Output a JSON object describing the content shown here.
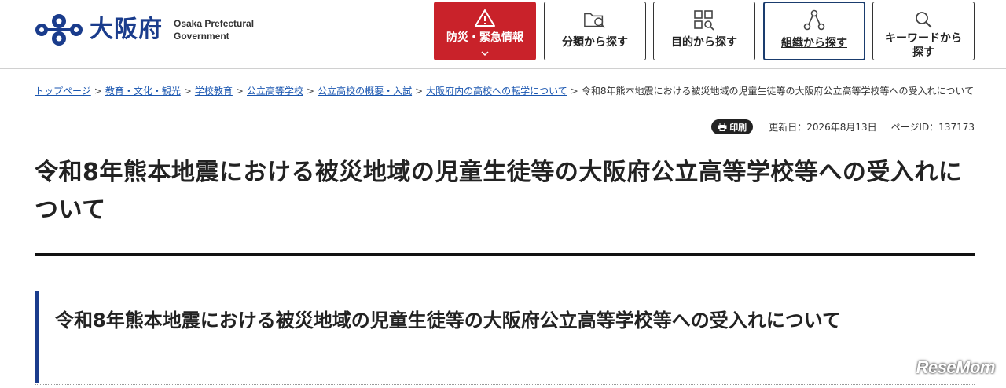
{
  "header": {
    "logo_jp": "大阪府",
    "logo_en_line1": "Osaka Prefectural",
    "logo_en_line2": "Government",
    "nav": [
      {
        "label": "防災・緊急情報",
        "icon": "warning-icon"
      },
      {
        "label": "分類から探す",
        "icon": "folder-search-icon"
      },
      {
        "label": "目的から探す",
        "icon": "grid-search-icon"
      },
      {
        "label": "組織から探す",
        "icon": "org-chart-icon"
      },
      {
        "label_line1": "キーワードから",
        "label_line2": "探す",
        "icon": "search-icon"
      }
    ]
  },
  "breadcrumb": {
    "items": [
      "トップページ",
      "教育・文化・観光",
      "学校教育",
      "公立高等学校",
      "公立高校の概要・入試",
      "大阪府内の高校への転学について"
    ],
    "current": "令和8年熊本地震における被災地域の児童生徒等の大阪府公立高等学校等への受入れについて",
    "separator": ">"
  },
  "meta": {
    "print_label": "印刷",
    "updated": "更新日：2026年8月13日",
    "page_id": "ページID：137173"
  },
  "page_title": "令和8年熊本地震における被災地域の児童生徒等の大阪府公立高等学校等への受入れについて",
  "section_heading": "令和8年熊本地震における被災地域の児童生徒等の大阪府公立高等学校等への受入れについて",
  "watermark": "ReseMom",
  "colors": {
    "brand_blue": "#1a3c8c",
    "emergency_red": "#c9222a",
    "link_blue": "#1a56b0"
  }
}
